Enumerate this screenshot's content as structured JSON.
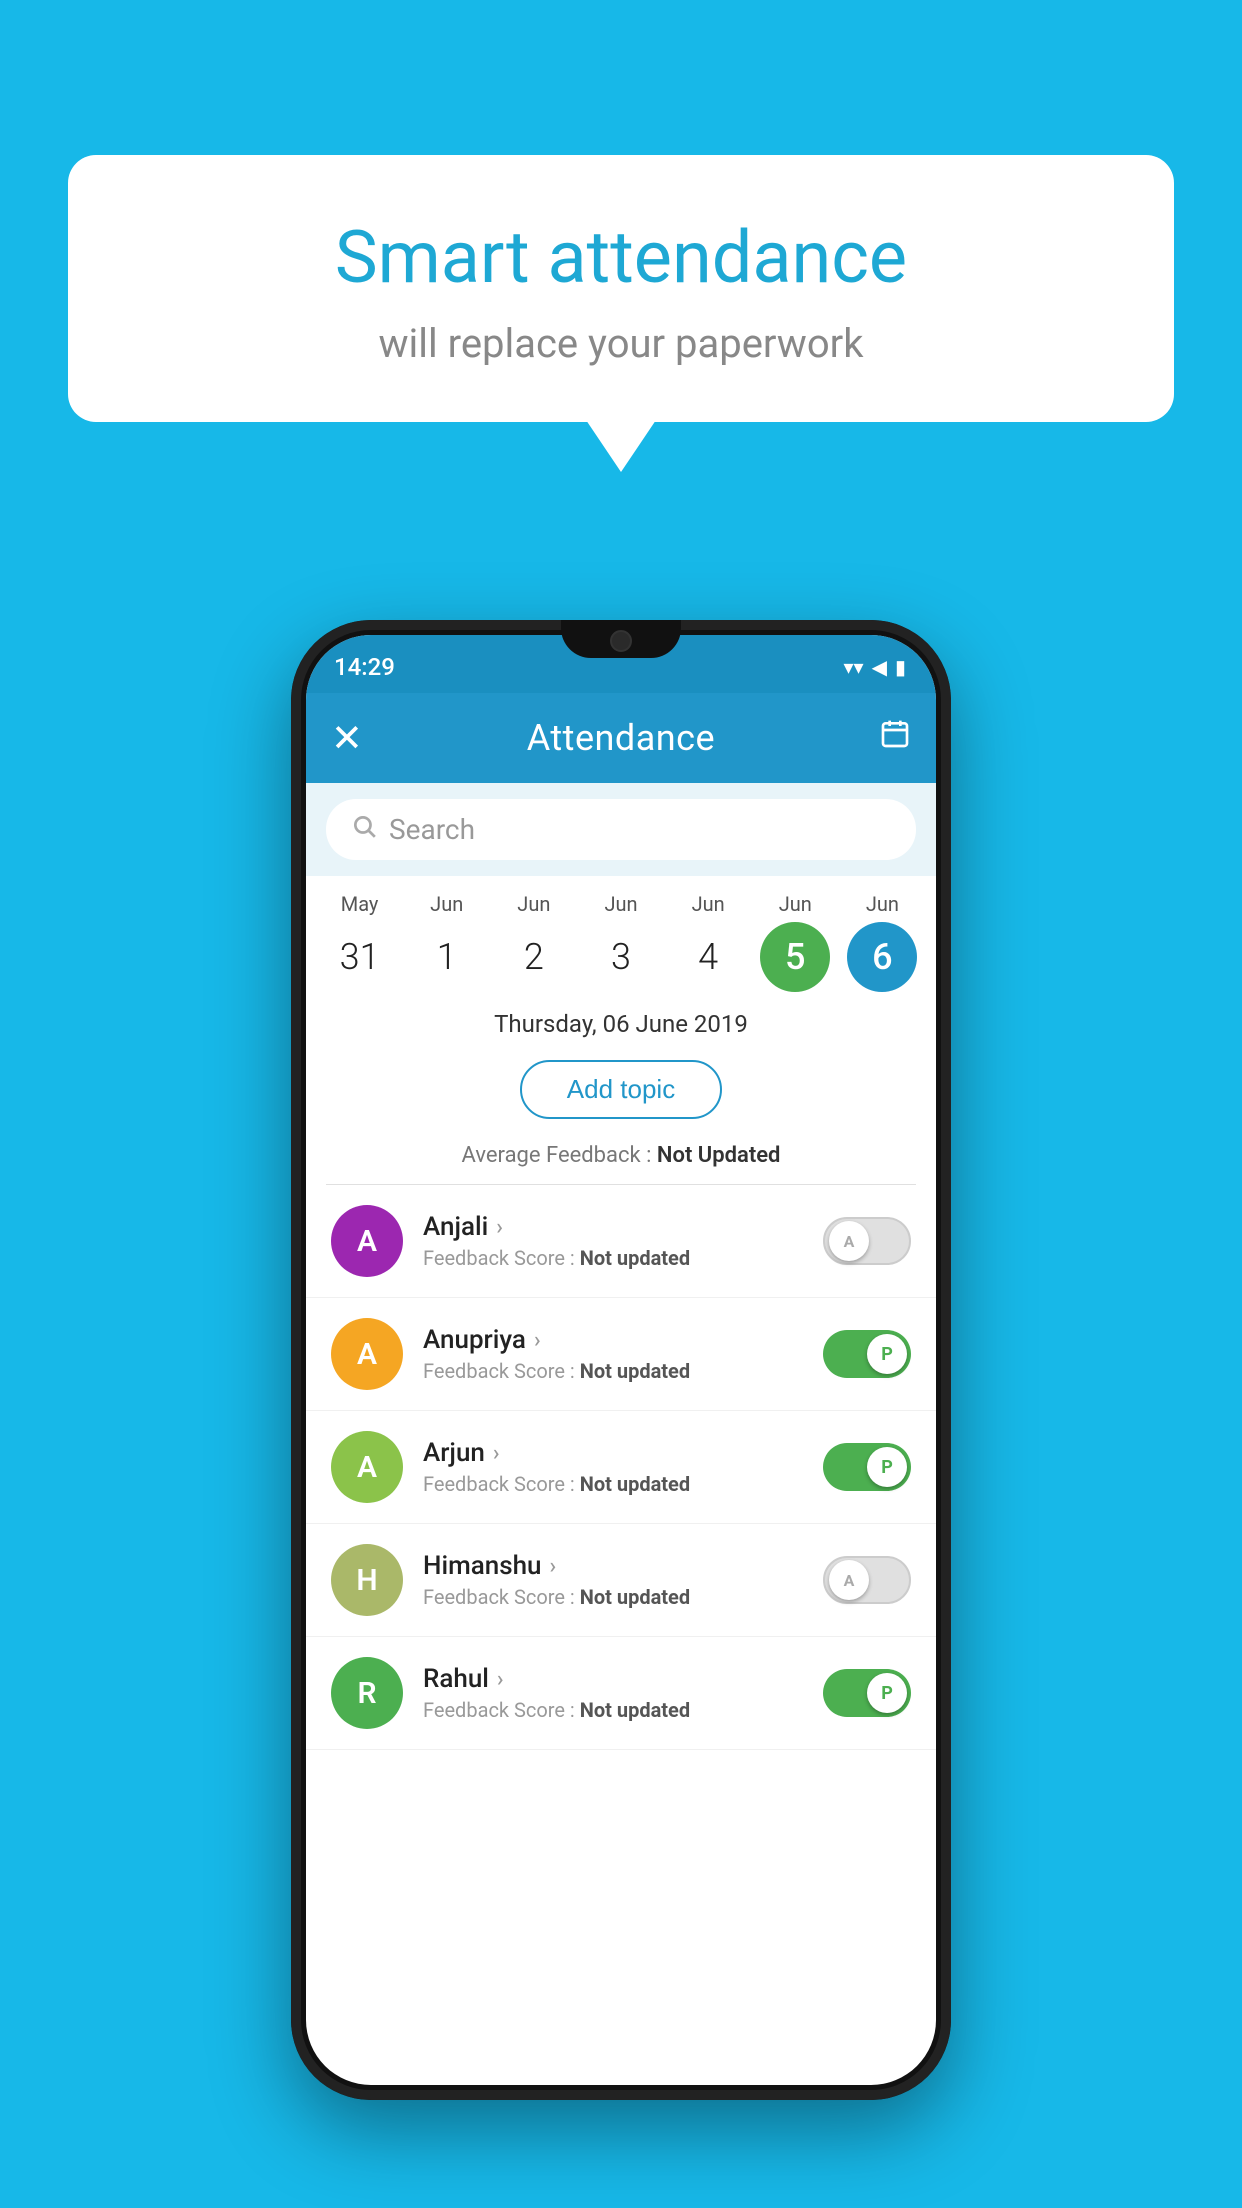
{
  "background_color": "#17b8e8",
  "speech_bubble": {
    "title": "Smart attendance",
    "subtitle": "will replace your paperwork"
  },
  "status_bar": {
    "time": "14:29",
    "wifi": "▼",
    "signal": "◀",
    "battery": "▮"
  },
  "app_bar": {
    "title": "Attendance",
    "close_label": "✕",
    "calendar_icon": "📅"
  },
  "search": {
    "placeholder": "Search"
  },
  "dates": [
    {
      "month": "May",
      "day": "31",
      "style": "normal"
    },
    {
      "month": "Jun",
      "day": "1",
      "style": "normal"
    },
    {
      "month": "Jun",
      "day": "2",
      "style": "normal"
    },
    {
      "month": "Jun",
      "day": "3",
      "style": "normal"
    },
    {
      "month": "Jun",
      "day": "4",
      "style": "normal"
    },
    {
      "month": "Jun",
      "day": "5",
      "style": "today"
    },
    {
      "month": "Jun",
      "day": "6",
      "style": "selected"
    }
  ],
  "selected_date": {
    "text": "Thursday, 06 June 2019"
  },
  "add_topic_btn": "Add topic",
  "average_feedback": {
    "label": "Average Feedback : ",
    "value": "Not Updated"
  },
  "students": [
    {
      "name": "Anjali",
      "avatar_letter": "A",
      "avatar_color": "#9c27b0",
      "feedback_label": "Feedback Score : ",
      "feedback_value": "Not updated",
      "toggle": "off",
      "toggle_letter": "A"
    },
    {
      "name": "Anupriya",
      "avatar_letter": "A",
      "avatar_color": "#f5a623",
      "feedback_label": "Feedback Score : ",
      "feedback_value": "Not updated",
      "toggle": "on",
      "toggle_letter": "P"
    },
    {
      "name": "Arjun",
      "avatar_letter": "A",
      "avatar_color": "#8bc34a",
      "feedback_label": "Feedback Score : ",
      "feedback_value": "Not updated",
      "toggle": "on",
      "toggle_letter": "P"
    },
    {
      "name": "Himanshu",
      "avatar_letter": "H",
      "avatar_color": "#aab869",
      "feedback_label": "Feedback Score : ",
      "feedback_value": "Not updated",
      "toggle": "off",
      "toggle_letter": "A"
    },
    {
      "name": "Rahul",
      "avatar_letter": "R",
      "avatar_color": "#4caf50",
      "feedback_label": "Feedback Score : ",
      "feedback_value": "Not updated",
      "toggle": "on",
      "toggle_letter": "P"
    }
  ]
}
